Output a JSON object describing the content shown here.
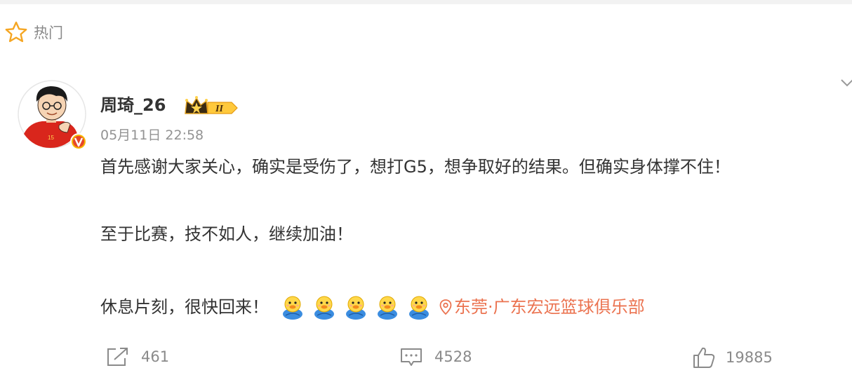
{
  "section": {
    "icon": "star-outline-icon",
    "label": "热门"
  },
  "post": {
    "author": {
      "name": "周琦_26",
      "badge_level": "II",
      "verified": true
    },
    "time": "05月11日 22:58",
    "text": {
      "line1": "首先感谢大家关心，确实是受伤了，想打G5，想争取好的结果。但确实身体撑不住！",
      "line2": "至于比赛，技不如人，继续加油！",
      "line3": "休息片刻，很快回来！"
    },
    "emoji_count": 5,
    "location": "东莞·广东宏远篮球俱乐部",
    "actions": {
      "repost_count": "461",
      "comment_count": "4528",
      "like_count": "19885"
    }
  },
  "colors": {
    "text": "#333333",
    "muted": "#939393",
    "link": "#eb7350",
    "star": "#f5a623",
    "verified": "#f7b500"
  }
}
